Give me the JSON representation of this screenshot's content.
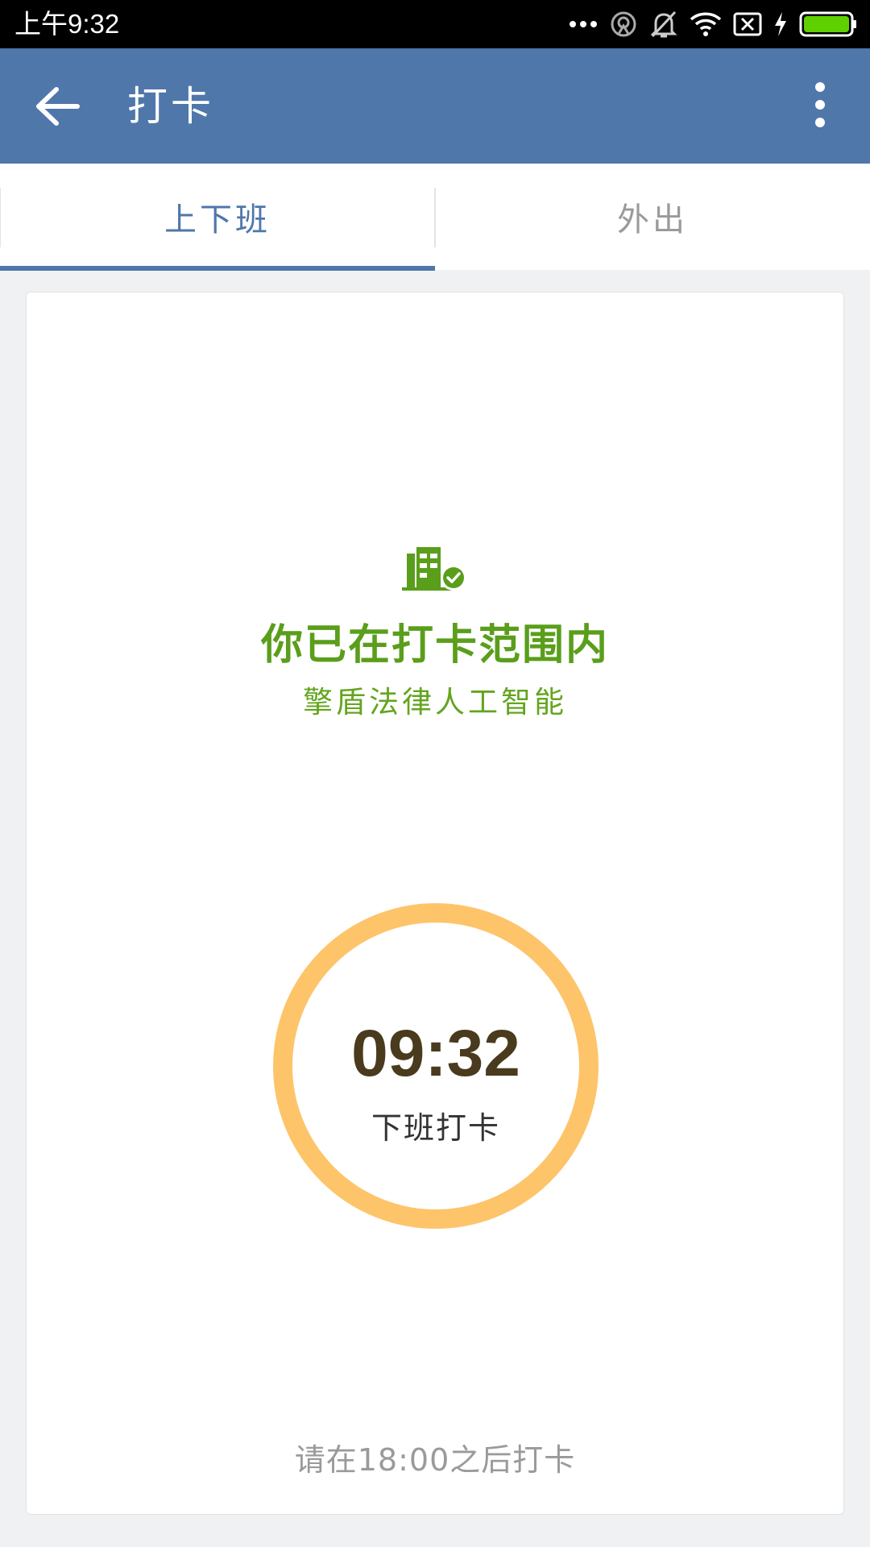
{
  "status_bar": {
    "time": "上午9:32",
    "icons": [
      "more-dots-icon",
      "hotspot-icon",
      "mute-bell-icon",
      "wifi-icon",
      "no-sim-icon",
      "charging-icon",
      "battery-icon"
    ],
    "battery_color": "#5fd000"
  },
  "app_bar": {
    "title": "打卡",
    "background": "#4f77aa",
    "back_icon": "arrow-left-icon",
    "menu_icon": "more-vert-icon"
  },
  "tabs": [
    {
      "label": "上下班",
      "active": true
    },
    {
      "label": "外出",
      "active": false
    }
  ],
  "location": {
    "icon": "building-check-icon",
    "status_text": "你已在打卡范围内",
    "company": "擎盾法律人工智能",
    "color": "#5a9e1b"
  },
  "punch": {
    "time": "09:32",
    "label": "下班打卡",
    "ring_color": "#fec46a"
  },
  "hint": "请在18:00之后打卡"
}
